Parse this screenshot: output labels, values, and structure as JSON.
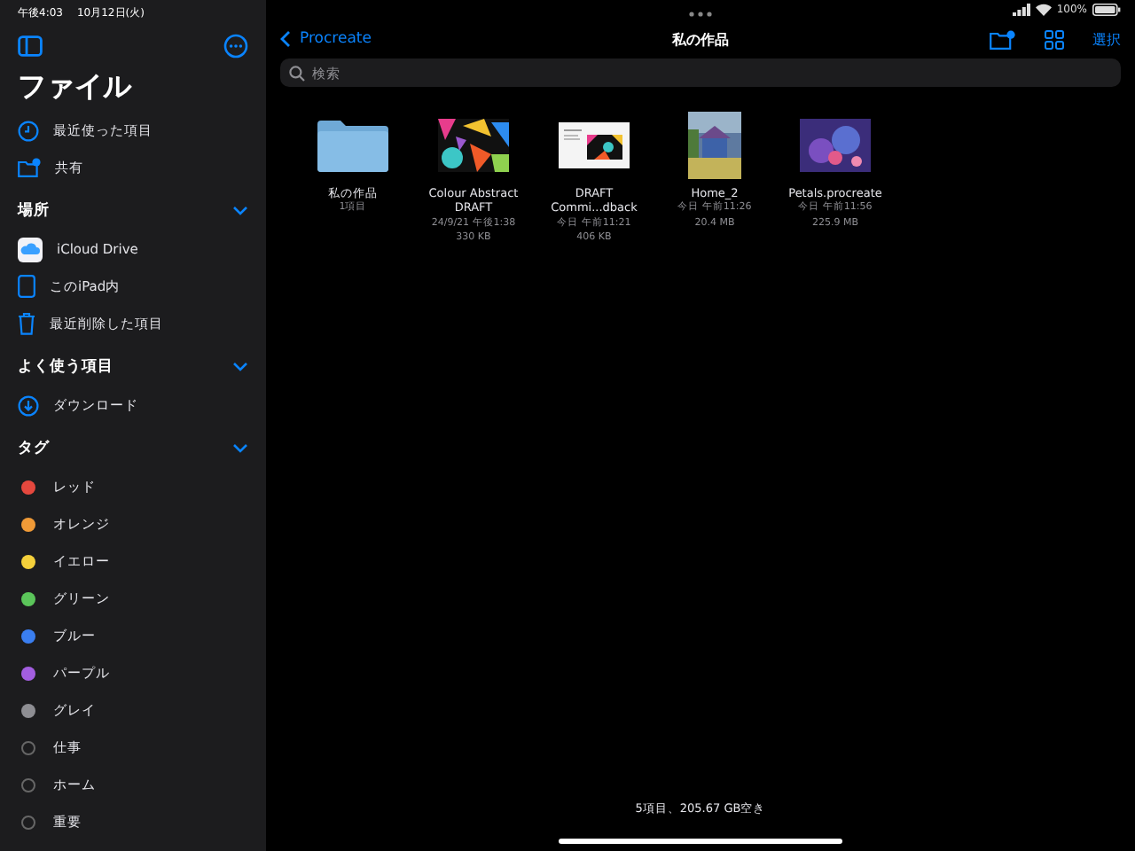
{
  "status_bar": {
    "time": "午後4:03",
    "date": "10月12日(火)",
    "battery": "100%"
  },
  "sidebar": {
    "title": "ファイル",
    "top_items": [
      {
        "label": "最近使った項目",
        "kind": "clock"
      },
      {
        "label": "共有",
        "kind": "shared"
      }
    ],
    "sections": [
      {
        "title": "場所",
        "expanded": true,
        "items": [
          {
            "label": "iCloud Drive",
            "kind": "cloud"
          },
          {
            "label": "このiPad内",
            "kind": "ipad"
          },
          {
            "label": "最近削除した項目",
            "kind": "trash"
          }
        ]
      },
      {
        "title": "よく使う項目",
        "expanded": true,
        "items": [
          {
            "label": "ダウンロード",
            "kind": "download"
          }
        ]
      },
      {
        "title": "タグ",
        "expanded": true,
        "items": [
          {
            "label": "レッド",
            "kind": "tag",
            "color": "#e5483e"
          },
          {
            "label": "オレンジ",
            "kind": "tag",
            "color": "#f09a37"
          },
          {
            "label": "イエロー",
            "kind": "tag",
            "color": "#f5d03b"
          },
          {
            "label": "グリーン",
            "kind": "tag",
            "color": "#5bc55a"
          },
          {
            "label": "ブルー",
            "kind": "tag",
            "color": "#3a7ef0"
          },
          {
            "label": "パープル",
            "kind": "tag",
            "color": "#a35ee0"
          },
          {
            "label": "グレイ",
            "kind": "tag",
            "color": "#8e8e93"
          },
          {
            "label": "仕事",
            "kind": "tag-outline"
          },
          {
            "label": "ホーム",
            "kind": "tag-outline"
          },
          {
            "label": "重要",
            "kind": "tag-outline"
          }
        ]
      }
    ]
  },
  "nav": {
    "back": "Procreate",
    "title": "私の作品",
    "select": "選択"
  },
  "search": {
    "placeholder": "検索"
  },
  "files": [
    {
      "kind": "folder",
      "name": "私の作品",
      "lines": [
        "1項目"
      ]
    },
    {
      "kind": "abstract",
      "name": "Colour Abstract DRAFT",
      "lines": [
        "24/9/21 午後1:38",
        "330 KB"
      ]
    },
    {
      "kind": "document",
      "name": "DRAFT Commi...dback",
      "lines": [
        "今日 午前11:21",
        "406 KB"
      ]
    },
    {
      "kind": "painting",
      "name": "Home_2",
      "lines": [
        "今日 午前11:26",
        "20.4 MB"
      ]
    },
    {
      "kind": "purple",
      "name": "Petals.procreate",
      "lines": [
        "今日 午前11:56",
        "225.9 MB"
      ]
    }
  ],
  "footer": "5項目、205.67 GB空き"
}
